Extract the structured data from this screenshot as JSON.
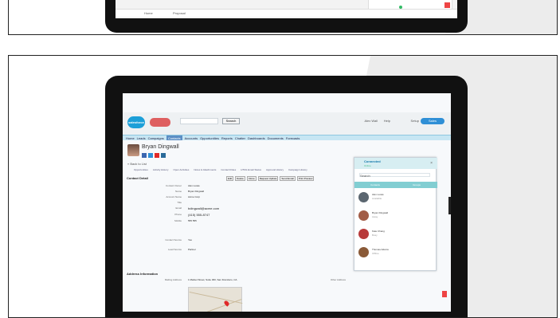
{
  "top_window": {
    "tabs": [
      "Home",
      "Proposal"
    ]
  },
  "header": {
    "logo_text": "salesforce",
    "search_button": "Search",
    "user_link": "Alex Wall",
    "help_link": "Help",
    "setup_link": "Setup",
    "app_button": "Sales"
  },
  "tabs": [
    "Home",
    "Leads",
    "Campaigns",
    "Contacts",
    "Accounts",
    "Opportunities",
    "Reports",
    "Chatter",
    "Dashboards",
    "Documents",
    "Forecasts"
  ],
  "active_tab": "Contacts",
  "profile": {
    "name": "Bryan Dingwall",
    "back_link": "« Back to List"
  },
  "related_list": [
    "Opportunities",
    "Activity History",
    "Open Activities",
    "Notes & Attachments",
    "Contact Roles",
    "HTML Email Status",
    "Approval History",
    "Campaign History"
  ],
  "detail": {
    "title": "Contact Detail",
    "buttons": [
      "Edit",
      "Delete",
      "Clone",
      "Request Update",
      "Send Email",
      "Print Preview"
    ],
    "rows": [
      {
        "label": "Contact Owner",
        "value": "Alex Lucas"
      },
      {
        "label": "Name",
        "value": "Bryan Dingwall"
      },
      {
        "label": "Account Name",
        "value": "Acme Corp"
      },
      {
        "label": "Title",
        "value": ""
      },
      {
        "label": "Email",
        "value": "bdingwall@acme.com"
      },
      {
        "label": "Phone",
        "value": "(415) 555-8747"
      },
      {
        "label": "Mobile",
        "value": "555 555"
      }
    ],
    "extra_label": "Contact Source",
    "extra_value": "Yes",
    "lead_label": "Lead Source",
    "lead_value": "Partner"
  },
  "address": {
    "title": "Address Information",
    "mailing_label": "Mailing Address",
    "mailing_value": "1 Market Street, Suite 300, San Francisco, CA",
    "other_label": "Other Address"
  },
  "sidebar": {
    "title": "Connected",
    "subtitle": "Online",
    "search_placeholder": "Search",
    "tabs": [
      "Contacts",
      "Groups"
    ],
    "contacts": [
      {
        "name": "Alex Lucas",
        "status": "Available",
        "color": "#5b6670"
      },
      {
        "name": "Bryan Dingwall",
        "status": "Away",
        "color": "#a15c46"
      },
      {
        "name": "Kate Chang",
        "status": "Busy",
        "color": "#b83a3a"
      },
      {
        "name": "Thomas Adams",
        "status": "Offline",
        "color": "#8a5a38"
      }
    ]
  },
  "colors": {
    "tab_bar": "#c7e6f3",
    "active_tab": "#5b8ec4",
    "sidebar_accent": "#82ced2",
    "brand": "#1c9fd8"
  }
}
